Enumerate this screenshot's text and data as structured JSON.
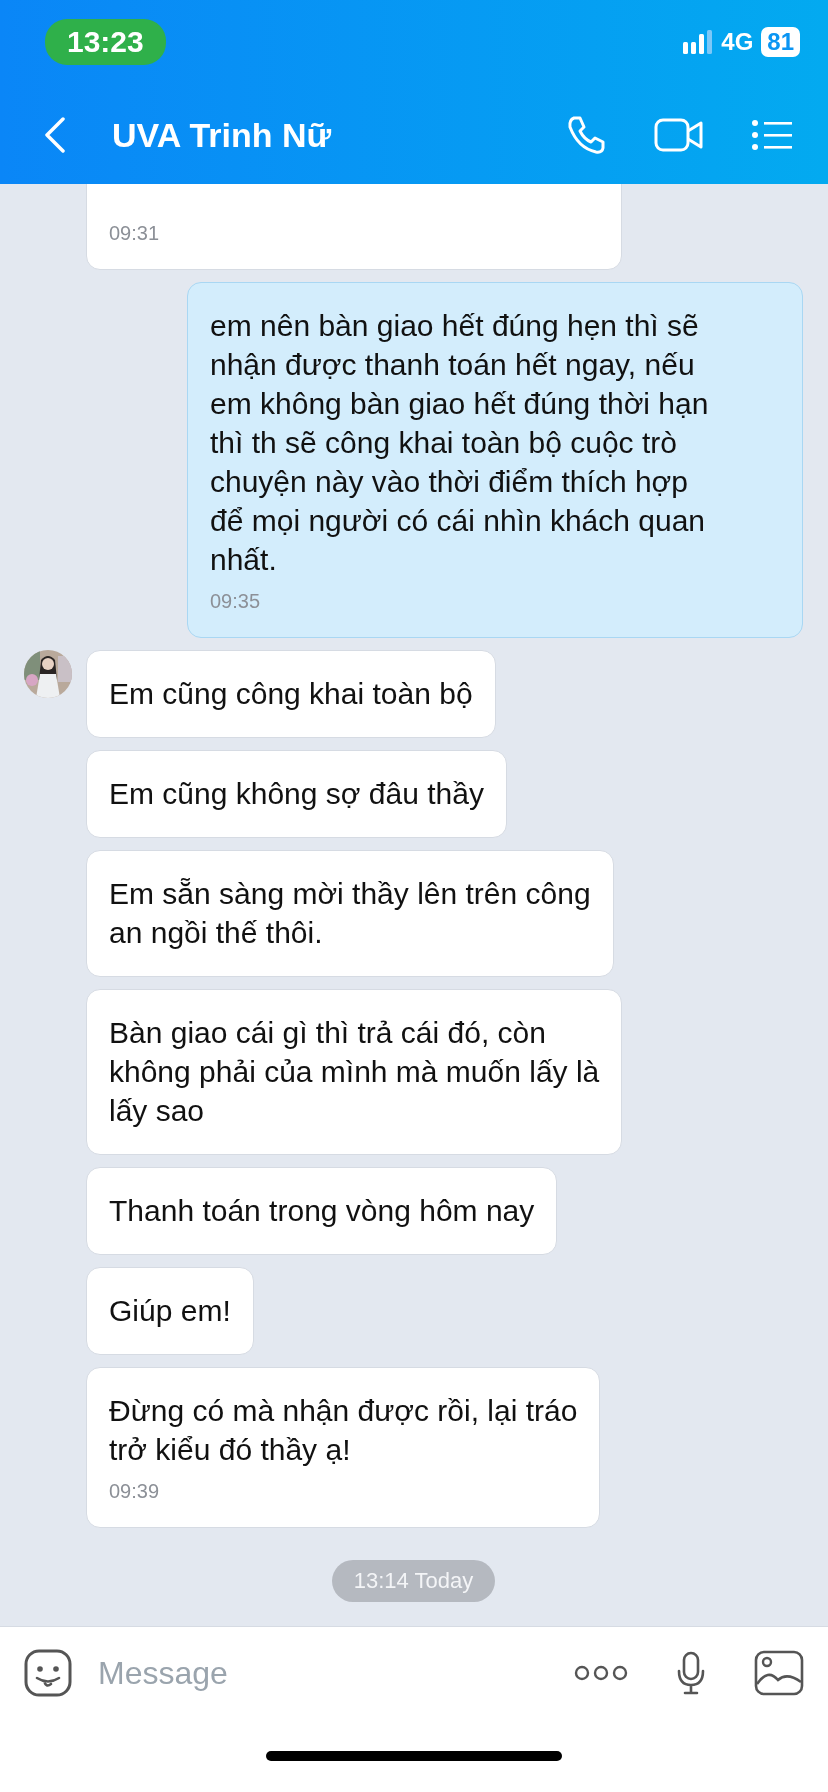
{
  "status_bar": {
    "time": "13:23",
    "network": "4G",
    "battery": "81"
  },
  "header": {
    "title": "UVA Trinh Nữ"
  },
  "messages": [
    {
      "kind": "received",
      "time": "09:31"
    },
    {
      "kind": "sent",
      "text": "em nên bàn giao hết đúng hẹn thì sẽ\nnhận được thanh toán hết ngay, nếu\nem không bàn giao hết đúng thời hạn\nthì th sẽ công khai toàn bộ cuộc trò\nchuyện này vào thời điểm thích hợp\nđể mọi người có cái nhìn khách quan\nnhất.",
      "time": "09:35"
    },
    {
      "kind": "received",
      "avatar": true,
      "text": "Em cũng công khai toàn bộ"
    },
    {
      "kind": "received",
      "avatar": false,
      "text": "Em cũng không sợ đâu thầy"
    },
    {
      "kind": "received",
      "avatar": false,
      "text": "Em sẵn sàng mời thầy lên trên công\nan ngồi thế thôi."
    },
    {
      "kind": "received",
      "avatar": false,
      "text": "Bàn giao cái gì thì trả cái đó, còn\nkhông phải của mình mà muốn lấy là\nlấy sao"
    },
    {
      "kind": "received",
      "avatar": false,
      "text": "Thanh toán trong vòng hôm nay"
    },
    {
      "kind": "received",
      "avatar": false,
      "text": "Giúp em!"
    },
    {
      "kind": "received",
      "avatar": false,
      "text": "Đừng có mà nhận được rồi, lại tráo\ntrở kiểu đó thầy ạ!",
      "time": "09:39"
    }
  ],
  "date_divider": "13:14 Today",
  "composer": {
    "placeholder": "Message"
  }
}
